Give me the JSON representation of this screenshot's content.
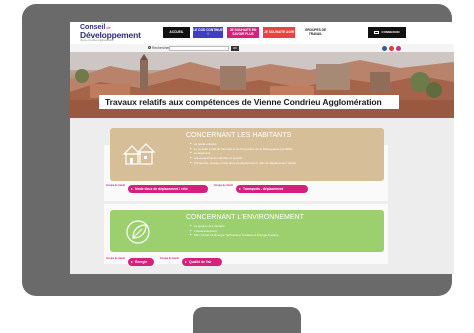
{
  "site": {
    "logo_line1": "Conseil",
    "logo_de": "de",
    "logo_line2": "Développement",
    "logo_sub": "Vienne Condrieu Agglomération"
  },
  "nav": {
    "accueil": "ACCUEIL",
    "cod": "LE COD CONTINUE !",
    "savoir": "JE SOUHAITE EN SAVOIR PLUS",
    "agir": "JE SOUHAITE AGIR",
    "groupes": "GROUPES DE TRAVAIL",
    "connexion": "CONNEXION"
  },
  "search": {
    "label": "Rechercher",
    "button": "OK"
  },
  "hero": {
    "title": "Travaux relatifs aux compétences de Vienne Condrieu Agglomération"
  },
  "sections": [
    {
      "title": "CONCERNANT LES HABITANTS",
      "color": "#d6bf98",
      "items": [
        "La petite enfance",
        "Le Conseil Local de Sécurité et de Prévention de la Délinquance (CLSPD)",
        "Le logement",
        "Les équipements culturels et sportifs",
        "Transports, réseau, mode doux de déplacement, plan de déplacement urbain"
      ],
      "tags": [
        {
          "prefix": "Groupe de travail",
          "label": "Mode doux de déplacement / vélo"
        },
        {
          "prefix": "Groupe de travail",
          "label": "Transports - déplacement"
        }
      ]
    },
    {
      "title": "CONCERNANT L'ENVIRONNEMENT",
      "color": "#9ccf6d",
      "items": [
        "La gestion des déchets",
        "L'assainissement",
        "Plan Climat Air Énergie Territorial et Territoire à Énergie Positive"
      ],
      "tags": [
        {
          "prefix": "Groupe de travail",
          "label": "Énergie"
        },
        {
          "prefix": "Groupe de travail",
          "label": "Qualité de l'air"
        }
      ]
    }
  ],
  "colors": {
    "bezel": "#6a6a6a",
    "brand_blue": "#2b2f7a",
    "brand_pink": "#d6207e",
    "nav_blue": "#3f3fc4",
    "nav_red": "#e8433e"
  },
  "icons": [
    "search-icon",
    "user-icon",
    "facebook-icon",
    "youtube-icon",
    "instagram-icon",
    "houses-icon",
    "leaf-icon",
    "arrow-icon"
  ]
}
